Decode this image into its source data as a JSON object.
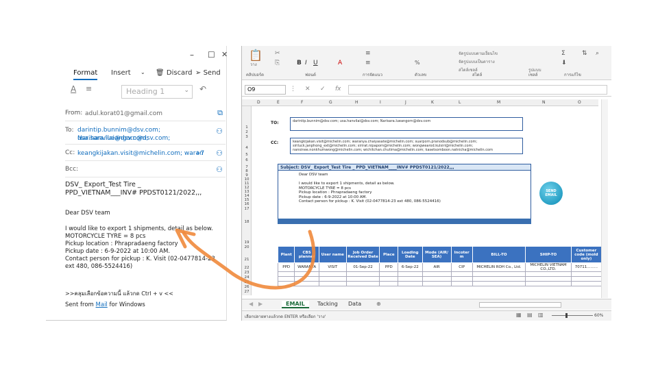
{
  "mail": {
    "window_controls": [
      "–",
      "☐",
      "✕"
    ],
    "tabs": {
      "format": "Format",
      "insert": "Insert",
      "discard": "Discard",
      "send": "Send"
    },
    "heading_placeholder": "Heading 1",
    "from_label": "From:",
    "from_value": "adul.korat01@gmail.com",
    "to_label": "To:",
    "to_line1": "darintip.bunnim@dsv.com;  usa.hanvilai@dsv.com;",
    "to_line2": "Narisara.lueangorn@dsv.com;",
    "cc_label": "Cc:",
    "cc_value": "keangkijakan.visit@michelin.com;  waran",
    "cc_more": "+7",
    "bcc_label": "Bcc:",
    "subject": "DSV_ Export_Test Tire _ PPD_VIETNAM___INV# PPDST0121/2022,,,",
    "greeting": "Dear     DSV team",
    "body": "I would like to export 1 shipments, detail as below.\nMOTORCYCLE TYRE   = 8 pcs\nPickup location : Phrapradaeng factory\nPickup date :   6-9-2022 at 10:00 AM.\nContact person for pickup :  K. Visit (02-0477814-23 ext 480, 086-5524416)",
    "thai_line": ">>คลุมเลือกข้อความนี้ แล้วกด Ctrl + v <<",
    "signature_prefix": "Sent from ",
    "signature_link": "Mail",
    "signature_suffix": " for Windows"
  },
  "excel": {
    "ribbon": {
      "clipboard_label": "คลิปบอร์ด",
      "font_label": "ฟอนต์",
      "align_label": "การจัดแนว",
      "number_label": "ตัวเลข",
      "styles_label": "สไตล์",
      "cells_label": "เซลล์",
      "editing_label": "การแก้ไข",
      "paste_label": "วาง",
      "cond_format": "จัดรูปแบบตามเงื่อนไข",
      "table_format": "จัดรูปแบบเป็นตาราง",
      "cell_styles": "สไตล์เซลล์",
      "cells_format": "รูปแบบ"
    },
    "name_box": "O9",
    "columns": [
      "D",
      "E",
      "F",
      "G",
      "H",
      "I",
      "J",
      "K",
      "L",
      "M",
      "N",
      "O"
    ],
    "rows": [
      "1",
      "2",
      "3",
      "4",
      "5",
      "6",
      "7",
      "8",
      "9",
      "10",
      "11",
      "12",
      "13",
      "14",
      "15",
      "16",
      "17",
      "18",
      "19",
      "20",
      "21",
      "22",
      "23",
      "24",
      "25",
      "26",
      "27"
    ],
    "to_label": "TO:",
    "to_value": "darintip.bunnim@dsv.com; usa.hanvilai@dsv.com; Narisara.lueangorn@dsv.com",
    "cc_label": "CC:",
    "cc_value": "keangkijakan.visit@michelin.com; waranya.chaiyasate@michelin.com; suarporn.pranodsub@michelin.com;\nsiriluck.janphong_ext@michelin.com; sirirat.nipaporn@michelin.com; wongwearod.kulsiri@michelin.com;\nnansinee.nonkhumwong@michelin.com; wichitchan.chutima@michelin.com; kasetsomboon.natnicha@michelin.com",
    "subject_bar": "Subject:  DSV_ Export_Test Tire _ PPD_VIETNAM____INV# PPDST0121/2022,,,",
    "email_body": "Dear     DSV team\n\nI would like to export 1 shipments, detail as below.\nMOTORCYCLE TYRE   = 8 pcs\nPickup location : Phrapradaeng factory\nPickup date :   6-9-2022 at 10:00 AM.\nContact person for pickup :   K. Visit (02-0477814-23 ext 480, 086-5524416)",
    "send_button": "SEND EMAIL",
    "table_headers": [
      "Plant",
      "CBS planner",
      "User name",
      "Job Order Received Date",
      "Place",
      "Loading Date",
      "Mode (AIR/ SEA)",
      "Incoter m",
      "BILL-TO",
      "SHIP-TO",
      "Customer code (mold only)",
      "P"
    ],
    "table_row": [
      "PPD",
      "WARANYA",
      "VISIT",
      "01-Sep-22",
      "PPD",
      "6-Sep-22",
      "AIR",
      "CIP",
      "MICHELIN ROH Co., Ltd.",
      "MICHELIN VIETNAM CO.,LTD.",
      "70711.........",
      "P"
    ],
    "sheet_tabs": [
      "EMAIL",
      "Tacking",
      "Data"
    ],
    "status_text": "เลือกปลายทางแล้วกด ENTER หรือเลือก 'วาง'",
    "zoom": "60%"
  }
}
